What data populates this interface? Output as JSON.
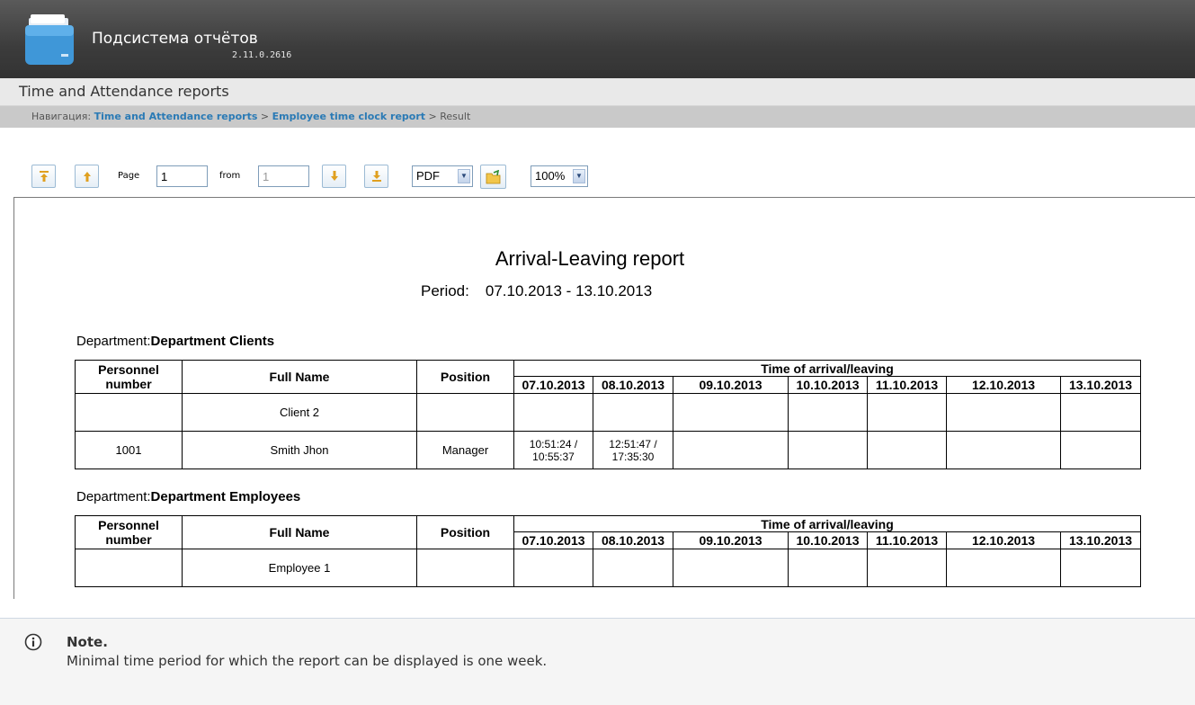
{
  "app": {
    "title": "Подсистема отчётов",
    "version": "2.11.0.2616"
  },
  "subheader": {
    "title": "Time and Attendance reports"
  },
  "breadcrumb": {
    "prefix": "Навигация:",
    "items": [
      "Time and Attendance reports",
      "Employee time clock report",
      "Result"
    ],
    "separator": ">"
  },
  "toolbar": {
    "page_label": "Page",
    "page_value": "1",
    "from_label": "from",
    "from_value": "1",
    "format_value": "PDF",
    "zoom_value": "100%"
  },
  "report": {
    "title": "Arrival-Leaving report",
    "period_label": "Period:",
    "period_value": "07.10.2013 - 13.10.2013",
    "department_label": "Department:",
    "columns": {
      "personnel": "Personnel number",
      "full_name": "Full Name",
      "position": "Position",
      "time_group": "Time of arrival/leaving"
    },
    "dates": [
      "07.10.2013",
      "08.10.2013",
      "09.10.2013",
      "10.10.2013",
      "11.10.2013",
      "12.10.2013",
      "13.10.2013"
    ],
    "departments": [
      {
        "name": "Department Clients",
        "rows": [
          {
            "personnel": "",
            "full_name": "Client 2",
            "position": "",
            "times": [
              "",
              "",
              "",
              "",
              "",
              "",
              ""
            ]
          },
          {
            "personnel": "1001",
            "full_name": "Smith Jhon",
            "position": "Manager",
            "times": [
              "10:51:24 / 10:55:37",
              "12:51:47 / 17:35:30",
              "",
              "",
              "",
              "",
              ""
            ]
          }
        ]
      },
      {
        "name": "Department Employees",
        "rows": [
          {
            "personnel": "",
            "full_name": "Employee 1",
            "position": "",
            "times": [
              "",
              "",
              "",
              "",
              "",
              "",
              ""
            ]
          }
        ]
      }
    ]
  },
  "note": {
    "title": "Note.",
    "text": "Minimal time period for which the report can be displayed is one week."
  },
  "icons": {
    "logo": "folder-icon",
    "first_page": "first-page-icon",
    "prev_page": "prev-page-icon",
    "next_page": "next-page-icon",
    "last_page": "last-page-icon",
    "export": "export-icon",
    "note": "info-icon"
  },
  "colors": {
    "header_bg": "#3c3c3c",
    "breadcrumb_link": "#2a7ab5",
    "button_border": "#9bbad4",
    "icon_arrow": "#e0a020"
  }
}
